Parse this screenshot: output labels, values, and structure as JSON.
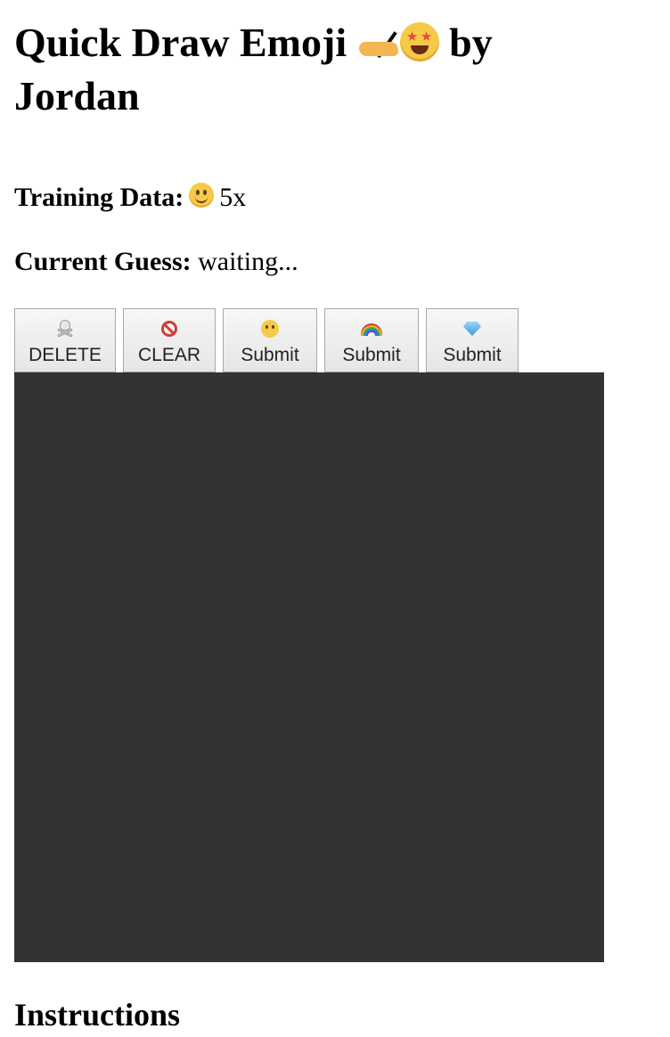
{
  "header": {
    "title_prefix": "Quick Draw Emoji",
    "title_suffix": "by Jordan"
  },
  "training": {
    "label": "Training Data:",
    "count": "5x"
  },
  "guess": {
    "label": "Current Guess:",
    "value": "waiting..."
  },
  "toolbar": {
    "buttons": [
      {
        "icon": "skull-crossbones-icon",
        "label": "DELETE"
      },
      {
        "icon": "no-entry-icon",
        "label": "CLEAR"
      },
      {
        "icon": "smiley-icon",
        "label": "Submit"
      },
      {
        "icon": "rainbow-icon",
        "label": "Submit"
      },
      {
        "icon": "gem-icon",
        "label": "Submit"
      }
    ]
  },
  "canvas": {
    "background": "#333333"
  },
  "instructions": {
    "heading": "Instructions"
  }
}
